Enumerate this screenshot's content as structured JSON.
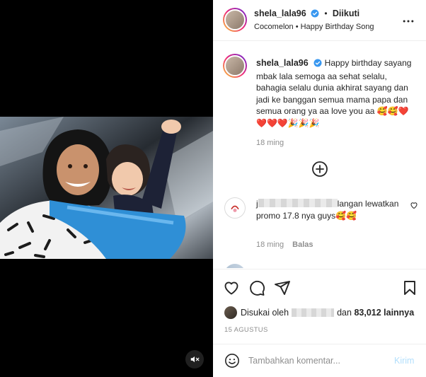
{
  "post": {
    "username": "shela_lala96",
    "follow_state": "Diikuti",
    "separator": "•",
    "audio": "Cocomelon • Happy Birthday Song",
    "more_icon": "more-horizontal-icon",
    "verified_icon": "verified-badge-icon"
  },
  "caption": {
    "username": "shela_lala96",
    "text": "Happy birthday sayang mbak lala semoga aa sehat selalu, bahagia selalu dunia akhirat sayang dan jadi ke banggan semua mama papa dan semua orang ya aa love you aa 🥰🥰❤️❤️❤️❤️🎉🎉🎉",
    "time": "18 ming"
  },
  "comment": {
    "user_prefix": "j",
    "text_after_redaction": "langan lewatkan promo 17.8 nya guys🥰🥰",
    "time": "18 ming",
    "reply_label": "Balas"
  },
  "likes": {
    "prefix": "Disukai oleh",
    "middle": "dan",
    "count_text": "83,012 lainnya"
  },
  "date": "15 AGUSTUS",
  "add_comment": {
    "placeholder": "Tambahkan komentar...",
    "post_label": "Kirim"
  },
  "colors": {
    "verified": "#3897f0",
    "post_button_disabled": "#b2dffc",
    "secondary_text": "#8e8e8e",
    "media_background": "#000000"
  }
}
